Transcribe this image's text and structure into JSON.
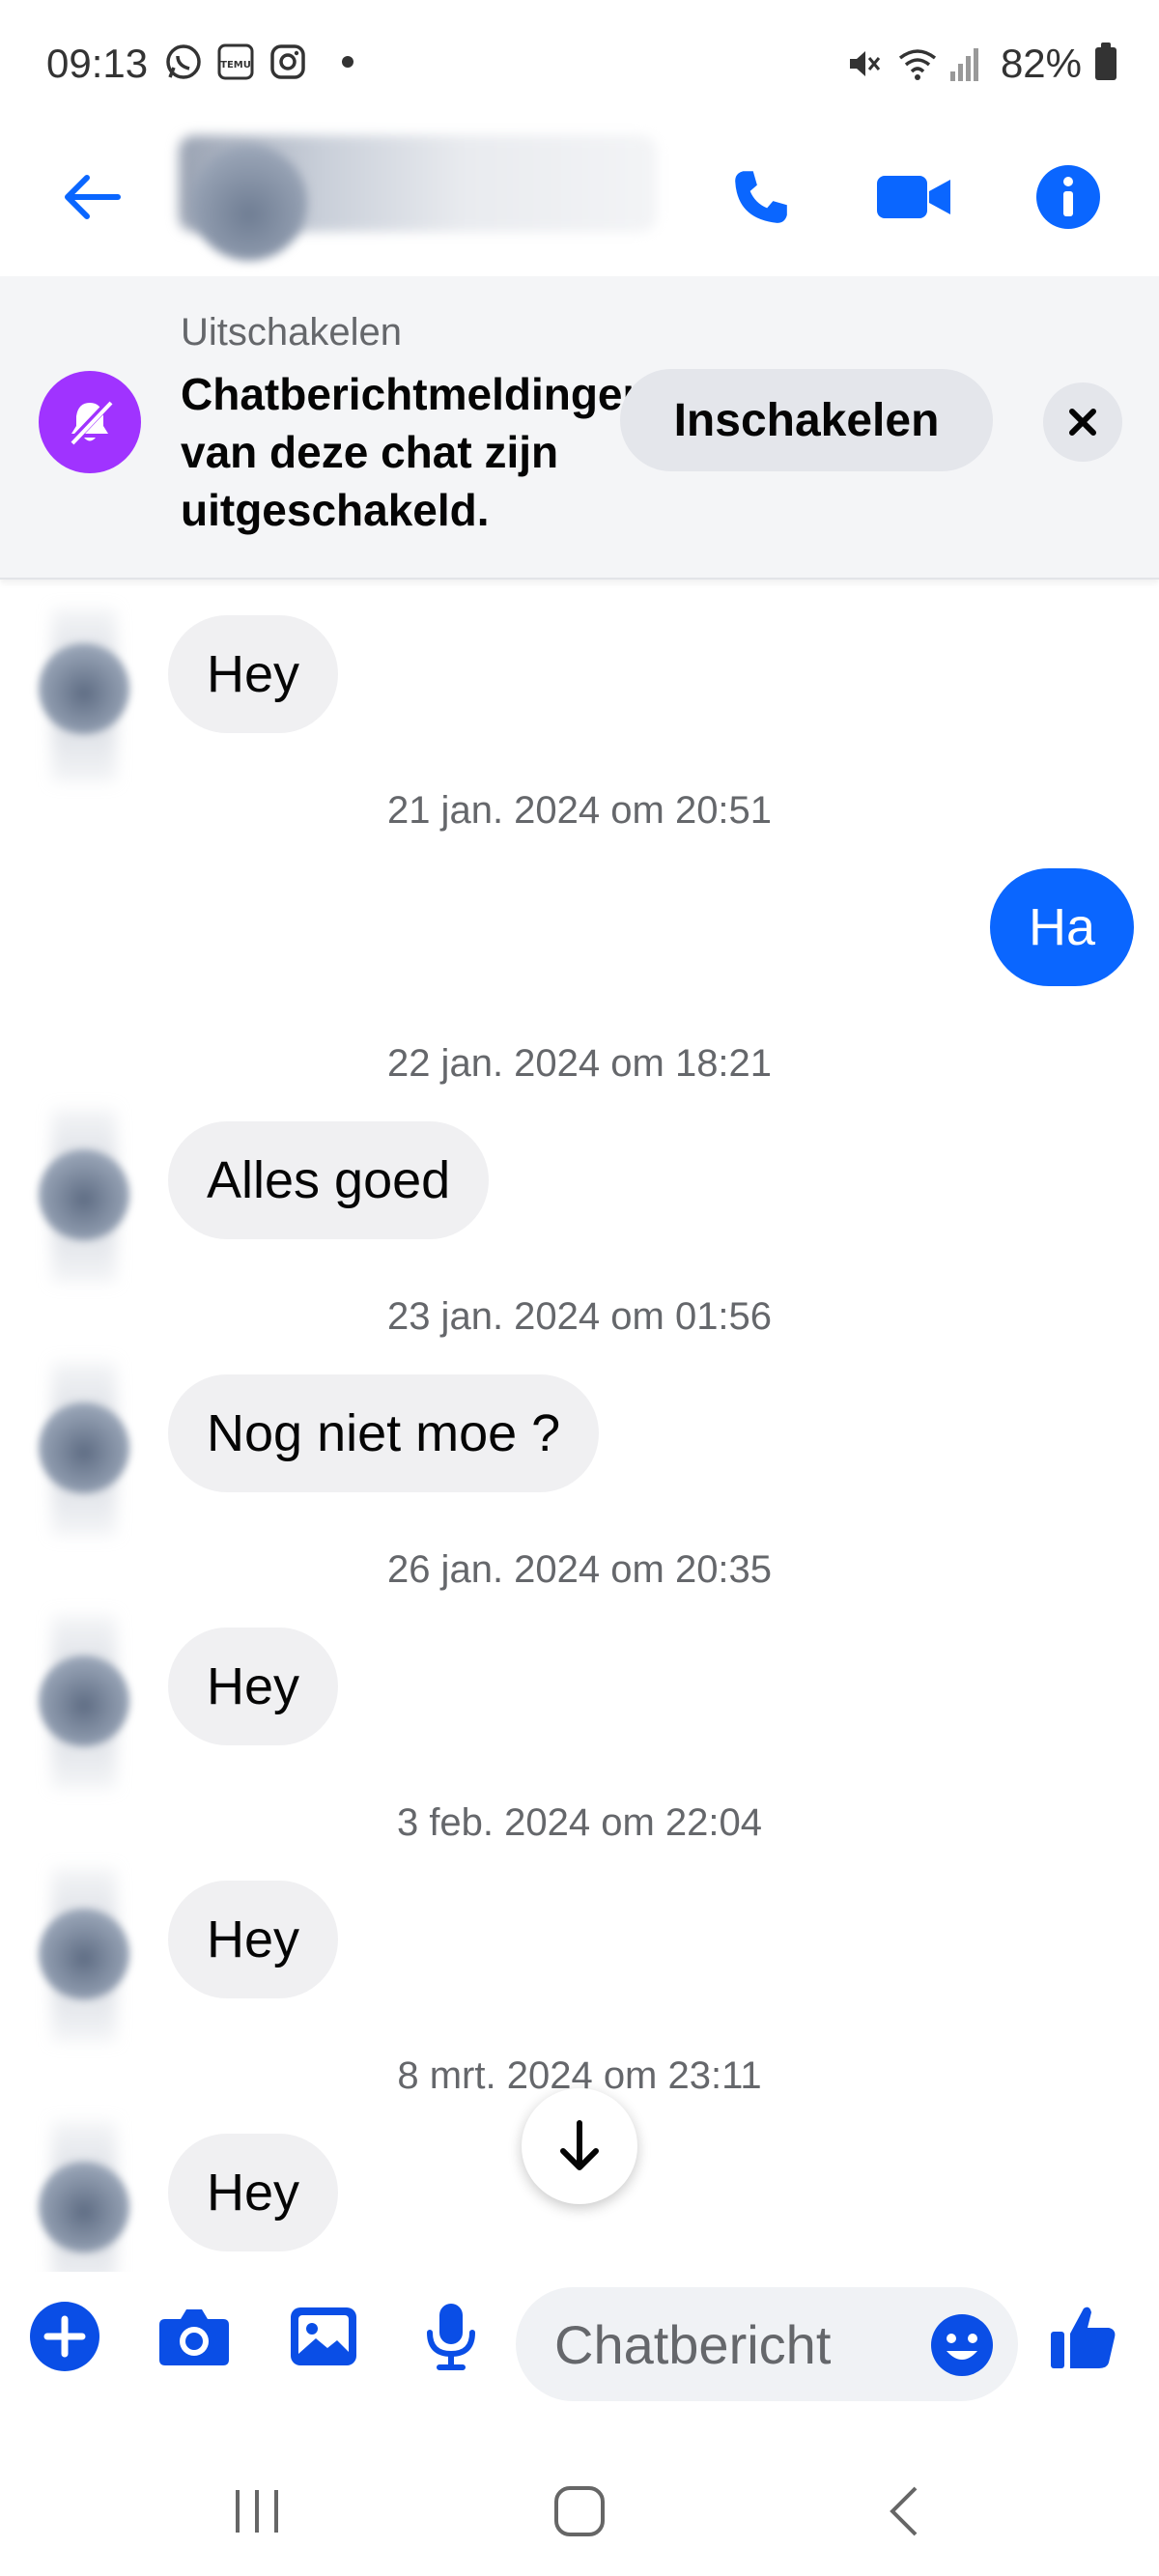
{
  "status_bar": {
    "time": "09:13",
    "battery": "82%",
    "left_icons": [
      "whatsapp-icon",
      "temu-icon",
      "instagram-icon"
    ],
    "right_icons": [
      "mute-icon",
      "wifi-icon",
      "signal-icon",
      "battery-icon"
    ]
  },
  "header": {
    "icons": [
      "back-arrow-icon",
      "phone-icon",
      "video-camera-icon",
      "info-icon"
    ],
    "accent_color": "#0a66ff"
  },
  "banner": {
    "title": "Uitschakelen",
    "text": "Chatberichtmeldingen van deze chat zijn uitgeschakeld.",
    "enable_label": "Inschakelen",
    "bell_color": "#a033ff"
  },
  "messages": [
    {
      "type": "in",
      "text": "Hey"
    },
    {
      "type": "timestamp",
      "text": "21 jan. 2024 om 20:51"
    },
    {
      "type": "out",
      "text": "Ha"
    },
    {
      "type": "timestamp",
      "text": "22 jan. 2024 om 18:21"
    },
    {
      "type": "in",
      "text": "Alles goed"
    },
    {
      "type": "timestamp",
      "text": "23 jan. 2024 om 01:56"
    },
    {
      "type": "in",
      "text": "Nog niet moe ?"
    },
    {
      "type": "timestamp",
      "text": "26 jan. 2024 om 20:35"
    },
    {
      "type": "in",
      "text": "Hey"
    },
    {
      "type": "timestamp",
      "text": "3 feb. 2024 om 22:04"
    },
    {
      "type": "in",
      "text": "Hey"
    },
    {
      "type": "timestamp",
      "text": "8 mrt. 2024 om 23:11"
    },
    {
      "type": "in",
      "text": "Hey"
    }
  ],
  "composer": {
    "placeholder": "Chatbericht",
    "icons": [
      "plus-icon",
      "camera-icon",
      "gallery-icon",
      "microphone-icon",
      "emoji-icon",
      "thumbs-up-icon"
    ]
  },
  "navbar": {
    "icons": [
      "recent-apps-icon",
      "home-icon",
      "back-icon"
    ]
  }
}
